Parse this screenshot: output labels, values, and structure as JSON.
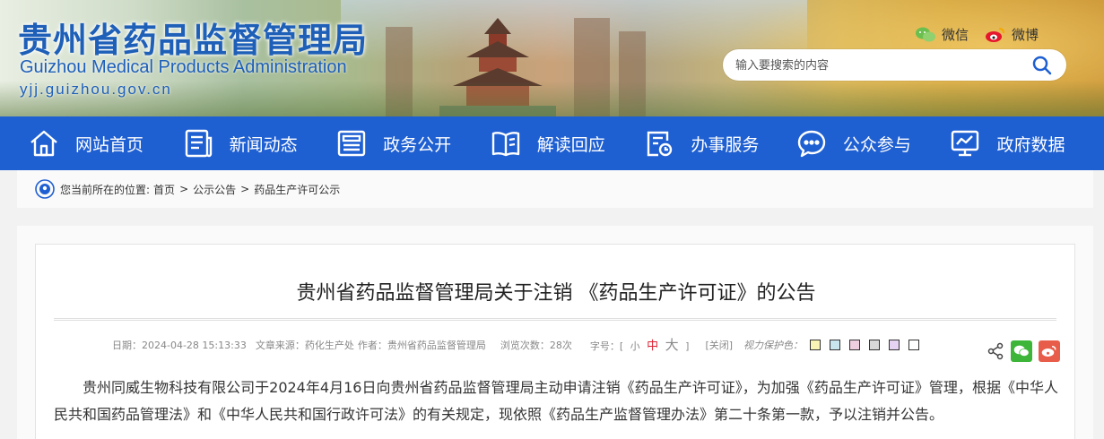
{
  "header": {
    "title_cn": "贵州省药品监督管理局",
    "title_en": "Guizhou Medical Products Administration",
    "url": "yjj.guizhou.gov.cn",
    "wechat_label": "微信",
    "weibo_label": "微博",
    "search_placeholder": "输入要搜索的内容"
  },
  "nav": {
    "items": [
      {
        "label": "网站首页",
        "icon": "home-icon"
      },
      {
        "label": "新闻动态",
        "icon": "news-icon"
      },
      {
        "label": "政务公开",
        "icon": "document-list-icon"
      },
      {
        "label": "解读回应",
        "icon": "book-icon"
      },
      {
        "label": "办事服务",
        "icon": "service-form-icon"
      },
      {
        "label": "公众参与",
        "icon": "chat-bubble-icon"
      },
      {
        "label": "政府数据",
        "icon": "data-monitor-icon"
      }
    ],
    "background": "#1e5fd2"
  },
  "breadcrumb": {
    "prefix": "您当前所在的位置:",
    "items": [
      "首页",
      "公示公告",
      "药品生产许可公示"
    ],
    "separator": ">"
  },
  "article": {
    "title": "贵州省药品监督管理局关于注销 《药品生产许可证》的公告",
    "meta": {
      "date": "日期：2024-04-28 15:13:33",
      "source": "文章来源：药化生产处",
      "author": "作者：贵州省药品监督管理局",
      "views": "浏览次数：28次",
      "font_size_label": "字号：[",
      "font_small": "小",
      "font_mid": "中",
      "font_big": "大",
      "font_close": "]",
      "close_label": "[关闭]",
      "eye_label": "视力保护色："
    },
    "swatches": [
      "#f9f3b6",
      "#c9e5ee",
      "#eecfe0",
      "#d9d9d9",
      "#e6d2f3",
      "#ffffff"
    ],
    "body": "贵州同威生物科技有限公司于2024年4月16日向贵州省药品监督管理局主动申请注销《药品生产许可证》，为加强《药品生产许可证》管理，根据《中华人民共和国药品管理法》和《中华人民共和国行政许可法》的有关规定，现依照《药品生产监督管理办法》第二十条第一款，予以注销并公告。"
  }
}
